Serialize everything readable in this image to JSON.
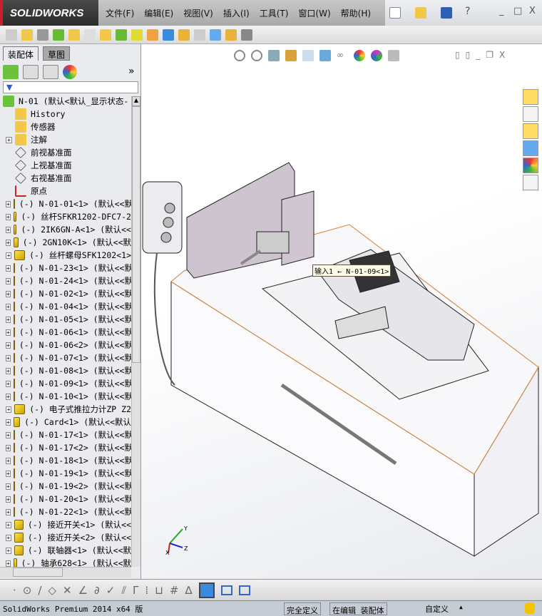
{
  "app": {
    "logo": "SOLIDWORKS"
  },
  "menu": [
    "文件(F)",
    "编辑(E)",
    "视图(V)",
    "插入(I)",
    "工具(T)",
    "窗口(W)",
    "帮助(H)"
  ],
  "panel": {
    "tabs": [
      "装配体",
      "草图"
    ],
    "collapse": "»"
  },
  "tree": [
    {
      "label": "N-01  (默认<默认_显示状态-",
      "icon": "assembly",
      "plus": false
    },
    {
      "label": "History",
      "icon": "history",
      "plus": false
    },
    {
      "label": "传感器",
      "icon": "sensor",
      "plus": false
    },
    {
      "label": "注解",
      "icon": "annotation",
      "plus": true
    },
    {
      "label": "前视基准面",
      "icon": "plane",
      "plus": false
    },
    {
      "label": "上视基准面",
      "icon": "plane",
      "plus": false
    },
    {
      "label": "右视基准面",
      "icon": "plane",
      "plus": false
    },
    {
      "label": "原点",
      "icon": "origin",
      "plus": false
    },
    {
      "label": "(-) N-01-01<1> (默认<<默",
      "icon": "part",
      "plus": true
    },
    {
      "label": "(-) 丝杆SFKR1202-DFC7-2",
      "icon": "part",
      "plus": true
    },
    {
      "label": "(-) 2IK6GN-A<1> (默认<<",
      "icon": "part",
      "plus": true
    },
    {
      "label": "(-) 2GN10K<1> (默认<<默",
      "icon": "part",
      "plus": true
    },
    {
      "label": "(-) 丝杆螺母SFK1202<1>",
      "icon": "part",
      "plus": true
    },
    {
      "label": "(-) N-01-23<1> (默认<<默",
      "icon": "part",
      "plus": true
    },
    {
      "label": "(-) N-01-24<1> (默认<<默",
      "icon": "part",
      "plus": true
    },
    {
      "label": "(-) N-01-02<1> (默认<<默",
      "icon": "part",
      "plus": true
    },
    {
      "label": "(-) N-01-04<1> (默认<<默",
      "icon": "part",
      "plus": true
    },
    {
      "label": "(-) N-01-05<1> (默认<<默",
      "icon": "part",
      "plus": true
    },
    {
      "label": "(-) N-01-06<1> (默认<<默",
      "icon": "part",
      "plus": true
    },
    {
      "label": "(-) N-01-06<2> (默认<<默",
      "icon": "part",
      "plus": true
    },
    {
      "label": "(-) N-01-07<1> (默认<<默",
      "icon": "part",
      "plus": true
    },
    {
      "label": "(-) N-01-08<1> (默认<<默",
      "icon": "part",
      "plus": true
    },
    {
      "label": "(-) N-01-09<1> (默认<<默",
      "icon": "part",
      "plus": true
    },
    {
      "label": "(-) N-01-10<1> (默认<<默",
      "icon": "part",
      "plus": true
    },
    {
      "label": "(-) 电子式推拉力计ZP Z2",
      "icon": "part",
      "plus": true
    },
    {
      "label": "(-) Card<1> (默认<<默认",
      "icon": "part",
      "plus": true
    },
    {
      "label": "(-) N-01-17<1> (默认<<默",
      "icon": "part",
      "plus": true
    },
    {
      "label": "(-) N-01-17<2> (默认<<默",
      "icon": "part",
      "plus": true
    },
    {
      "label": "(-) N-01-18<1> (默认<<默",
      "icon": "part",
      "plus": true
    },
    {
      "label": "(-) N-01-19<1> (默认<<默",
      "icon": "part",
      "plus": true
    },
    {
      "label": "(-) N-01-19<2> (默认<<默",
      "icon": "part",
      "plus": true
    },
    {
      "label": "(-) N-01-20<1> (默认<<默",
      "icon": "part",
      "plus": true
    },
    {
      "label": "(-) N-01-22<1> (默认<<默",
      "icon": "part",
      "plus": true
    },
    {
      "label": "(-) 接近开关<1> (默认<<",
      "icon": "part",
      "plus": true
    },
    {
      "label": "(-) 接近开关<2> (默认<<",
      "icon": "part",
      "plus": true
    },
    {
      "label": "(-) 联轴器<1> (默认<<默",
      "icon": "part",
      "plus": true
    },
    {
      "label": "(-) 轴承628<1> (默认<<默",
      "icon": "part",
      "plus": true
    }
  ],
  "viewport": {
    "tooltip": "输入1 ← N-01-09<1>",
    "axes": {
      "x": "X",
      "y": "Y",
      "z": "Z"
    }
  },
  "status": {
    "product": "SolidWorks Premium 2014 x64 版",
    "definition": "完全定义",
    "mode": "在编辑 装配体",
    "units": "自定义",
    "units_arrow": "▲"
  },
  "colors": {
    "accent": "#c8202a",
    "part": "#e8c400"
  }
}
